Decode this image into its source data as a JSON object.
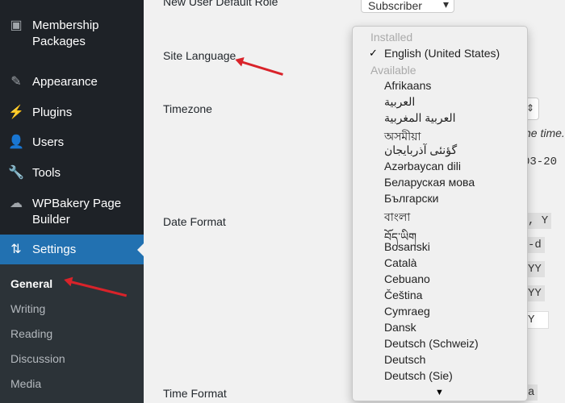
{
  "sidebar": {
    "items": [
      {
        "label": "Membership Packages",
        "icon": "calendar-icon"
      },
      {
        "label": "Appearance",
        "icon": "paintbrush-icon"
      },
      {
        "label": "Plugins",
        "icon": "plugin-icon"
      },
      {
        "label": "Users",
        "icon": "user-icon"
      },
      {
        "label": "Tools",
        "icon": "wrench-icon"
      },
      {
        "label": "WPBakery Page Builder",
        "icon": "cloud-icon"
      },
      {
        "label": "Settings",
        "icon": "settings-icon",
        "active": true
      }
    ],
    "submenu": [
      "General",
      "Writing",
      "Reading",
      "Discussion",
      "Media"
    ],
    "active_color": "#2271b1"
  },
  "form": {
    "labels": {
      "default_role": "New User Default Role",
      "site_language": "Site Language",
      "timezone": "Timezone",
      "date_format": "Date Format",
      "time_format": "Time Format"
    },
    "default_role_value": "Subscriber",
    "fragments": {
      "timezone_hint": "ne time.",
      "date_sample": "03-20",
      "date_codes": [
        ", Y",
        "-d",
        "YY",
        "YY",
        "Y"
      ],
      "time_code": "a"
    }
  },
  "language_dropdown": {
    "installed_label": "Installed",
    "selected": "English (United States)",
    "available_label": "Available",
    "options": [
      "Afrikaans",
      "العربية",
      "العربية المغربية",
      "অসমীয়া",
      "گؤنئی آذربایجان",
      "Azərbaycan dili",
      "Беларуская мова",
      "Български",
      "বাংলা",
      "བོད་ཡིག",
      "Bosanski",
      "Català",
      "Cebuano",
      "Čeština",
      "Cymraeg",
      "Dansk",
      "Deutsch (Schweiz)",
      "Deutsch",
      "Deutsch (Sie)"
    ]
  },
  "annotation_color": "#d9232a"
}
